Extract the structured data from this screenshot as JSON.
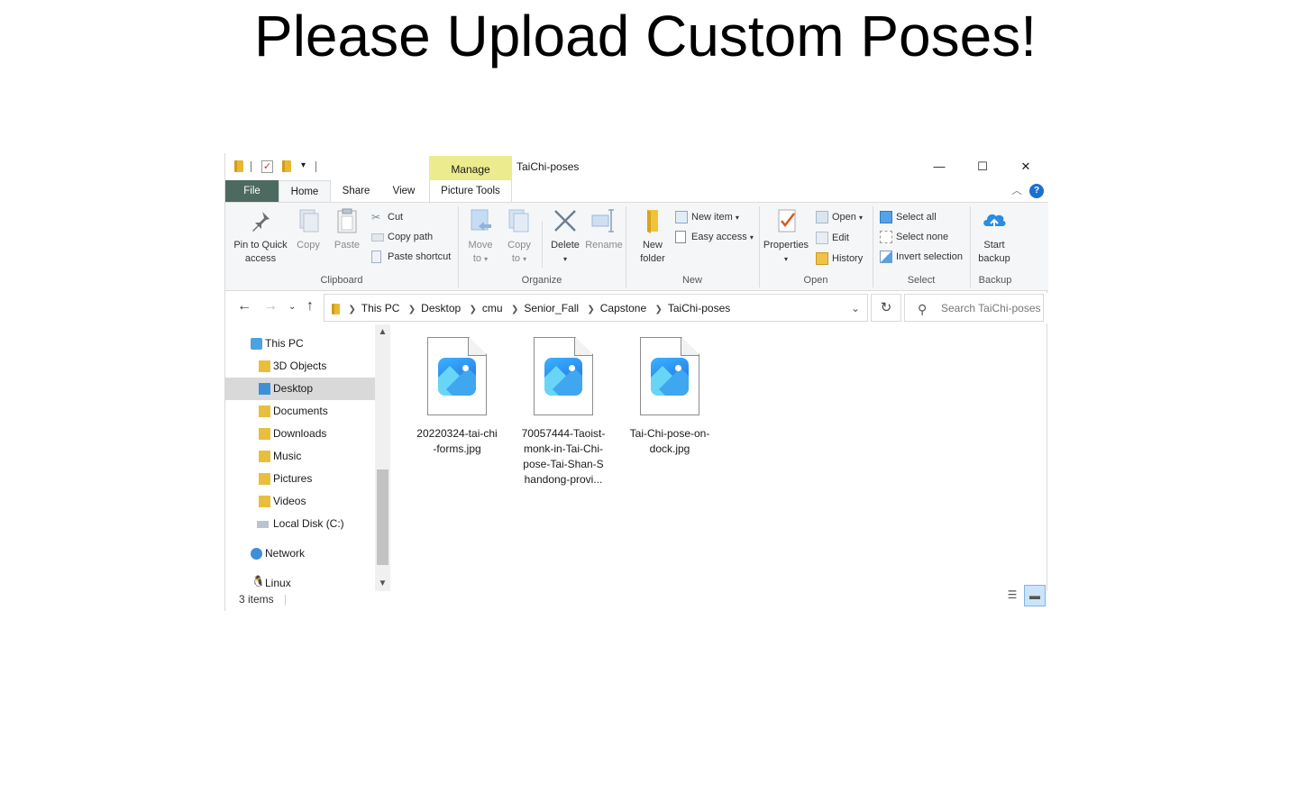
{
  "page": {
    "heading": "Please Upload Custom Poses!"
  },
  "window": {
    "title": "TaiChi-poses",
    "context_tab": "Manage",
    "controls": {
      "minimize": "—",
      "maximize": "☐",
      "close": "✕"
    }
  },
  "tabs": {
    "file": "File",
    "home": "Home",
    "share": "Share",
    "view": "View",
    "picture_tools": "Picture Tools"
  },
  "ribbon": {
    "clipboard": {
      "label": "Clipboard",
      "pin_line1": "Pin to Quick",
      "pin_line2": "access",
      "copy": "Copy",
      "paste": "Paste",
      "cut": "Cut",
      "copy_path": "Copy path",
      "paste_shortcut": "Paste shortcut"
    },
    "organize": {
      "label": "Organize",
      "move_line1": "Move",
      "move_line2": "to",
      "copy_line1": "Copy",
      "copy_line2": "to",
      "delete": "Delete",
      "rename": "Rename"
    },
    "new": {
      "label": "New",
      "folder_line1": "New",
      "folder_line2": "folder",
      "new_item": "New item",
      "easy_access": "Easy access"
    },
    "open": {
      "label": "Open",
      "properties": "Properties",
      "open": "Open",
      "edit": "Edit",
      "history": "History"
    },
    "select": {
      "label": "Select",
      "select_all": "Select all",
      "select_none": "Select none",
      "invert_selection": "Invert selection"
    },
    "backup": {
      "label": "Backup",
      "start_line1": "Start",
      "start_line2": "backup"
    }
  },
  "address": {
    "crumbs": [
      "This PC",
      "Desktop",
      "cmu",
      "Senior_Fall",
      "Capstone",
      "TaiChi-poses"
    ],
    "search_placeholder": "Search TaiChi-poses"
  },
  "sidebar": {
    "items": [
      {
        "label": "This PC",
        "icon": "computer-icon"
      },
      {
        "label": "3D Objects",
        "icon": "3d-objects-folder-icon"
      },
      {
        "label": "Desktop",
        "icon": "desktop-folder-icon",
        "selected": true
      },
      {
        "label": "Documents",
        "icon": "documents-folder-icon"
      },
      {
        "label": "Downloads",
        "icon": "downloads-folder-icon"
      },
      {
        "label": "Music",
        "icon": "music-folder-icon"
      },
      {
        "label": "Pictures",
        "icon": "pictures-folder-icon"
      },
      {
        "label": "Videos",
        "icon": "videos-folder-icon"
      },
      {
        "label": "Local Disk (C:)",
        "icon": "disk-icon"
      },
      {
        "label": "Network",
        "icon": "network-icon"
      },
      {
        "label": "Linux",
        "icon": "linux-icon"
      }
    ]
  },
  "files": [
    {
      "name_line1": "20220324-tai-chi",
      "name_line2": "-forms.jpg",
      "name_line3": "",
      "name_line4": ""
    },
    {
      "name_line1": "70057444-Taoist-",
      "name_line2": "monk-in-Tai-Chi-",
      "name_line3": "pose-Tai-Shan-S",
      "name_line4": "handong-provi..."
    },
    {
      "name_line1": "Tai-Chi-pose-on-",
      "name_line2": "dock.jpg",
      "name_line3": "",
      "name_line4": ""
    }
  ],
  "status": {
    "count": "3 items"
  }
}
